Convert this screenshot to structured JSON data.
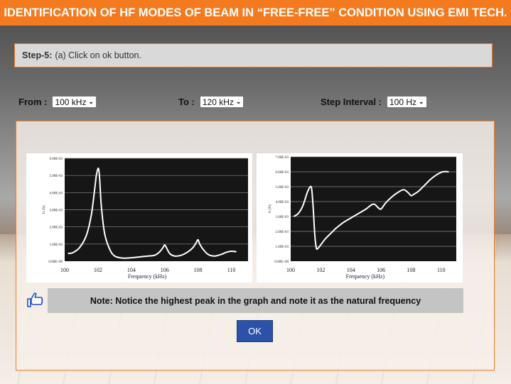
{
  "header": {
    "title": "IDENTIFICATION OF HF MODES OF BEAM IN “FREE-FREE” CONDITION USING EMI TECH."
  },
  "step": {
    "label": "Step-5:",
    "text": " (a) Click on ok button."
  },
  "controls": {
    "from_label": "From :",
    "from_value": "100 kHz",
    "to_label": "To :",
    "to_value": "120 kHz",
    "interval_label": "Step Interval :",
    "interval_value": "100 Hz"
  },
  "note": {
    "text": "Note: Notice the highest peak in the graph and note it as the natural frequency"
  },
  "ok_button": {
    "label": "OK"
  },
  "icons": {
    "hand": "pointing-hand-icon",
    "chevron": "chevron-down-icon"
  },
  "colors": {
    "accent": "#f47a1f",
    "button": "#2b52a8",
    "plot_bg": "#161616",
    "note_bg": "#c4c4c4"
  },
  "chart_data": [
    {
      "type": "line",
      "xlabel": "Frequency (kHz)",
      "ylabel": "G (S)",
      "xticks": [
        "100",
        "102",
        "104",
        "106",
        "108",
        "110"
      ],
      "yticks": [
        "0.00E+00",
        "1.00E-03",
        "2.00E-03",
        "3.00E-03",
        "4.00E-03",
        "5.00E-03",
        "6.00E-03"
      ],
      "xlim": [
        100,
        111
      ],
      "ylim": [
        0,
        0.006
      ],
      "grid": "horizontal",
      "series": [
        {
          "x": [
            100.2,
            100.5,
            100.9,
            101.3,
            101.6,
            101.8,
            101.9,
            102.0,
            102.05,
            102.1,
            102.2,
            102.4,
            102.7,
            103.0,
            103.5,
            104.0,
            104.5,
            105.0,
            105.4,
            105.7,
            105.9,
            106.0,
            106.1,
            106.3,
            106.6,
            107.0,
            107.4,
            107.7,
            107.9,
            108.0,
            108.1,
            108.3,
            108.6,
            109.0,
            109.4,
            109.7,
            110.0,
            110.3
          ],
          "y": [
            0.00045,
            0.0005,
            0.0008,
            0.0015,
            0.0027,
            0.0042,
            0.005,
            0.0054,
            0.0053,
            0.0048,
            0.0032,
            0.0016,
            0.0007,
            0.0003,
            0.00018,
            0.0002,
            0.00025,
            0.0003,
            0.00035,
            0.00055,
            0.0008,
            0.00095,
            0.0008,
            0.00045,
            0.0003,
            0.00035,
            0.00055,
            0.0008,
            0.0011,
            0.00125,
            0.001,
            0.0007,
            0.0004,
            0.0003,
            0.0004,
            0.00052,
            0.00058,
            0.00055
          ]
        }
      ]
    },
    {
      "type": "line",
      "xlabel": "Frequency (kHz)",
      "ylabel": "G (S)",
      "xticks": [
        "100",
        "102",
        "104",
        "106",
        "108",
        "110"
      ],
      "yticks": [
        "0.00E+00",
        "1.00E-03",
        "2.00E-03",
        "3.00E-03",
        "4.00E-03",
        "5.00E-03",
        "6.00E-03",
        "7.00E-03"
      ],
      "xlim": [
        100,
        111
      ],
      "ylim": [
        0,
        0.007
      ],
      "grid": "horizontal",
      "series": [
        {
          "x": [
            100.2,
            100.5,
            100.8,
            101.1,
            101.3,
            101.4,
            101.5,
            101.6,
            101.7,
            101.8,
            102.0,
            102.3,
            102.7,
            103.0,
            103.5,
            104.0,
            104.5,
            105.0,
            105.4,
            105.6,
            105.8,
            106.0,
            106.3,
            106.7,
            107.1,
            107.5,
            107.8,
            108.0,
            108.2,
            108.5,
            108.9,
            109.3,
            109.7,
            110.1,
            110.5
          ],
          "y": [
            0.003,
            0.0032,
            0.0037,
            0.0046,
            0.005,
            0.0048,
            0.0035,
            0.0018,
            0.0009,
            0.00085,
            0.0011,
            0.0015,
            0.0019,
            0.0022,
            0.0026,
            0.0029,
            0.0032,
            0.0035,
            0.0038,
            0.0038,
            0.0036,
            0.0035,
            0.0039,
            0.0043,
            0.0046,
            0.0048,
            0.0046,
            0.0044,
            0.0045,
            0.0047,
            0.0051,
            0.0055,
            0.0058,
            0.006,
            0.006
          ]
        }
      ]
    }
  ]
}
